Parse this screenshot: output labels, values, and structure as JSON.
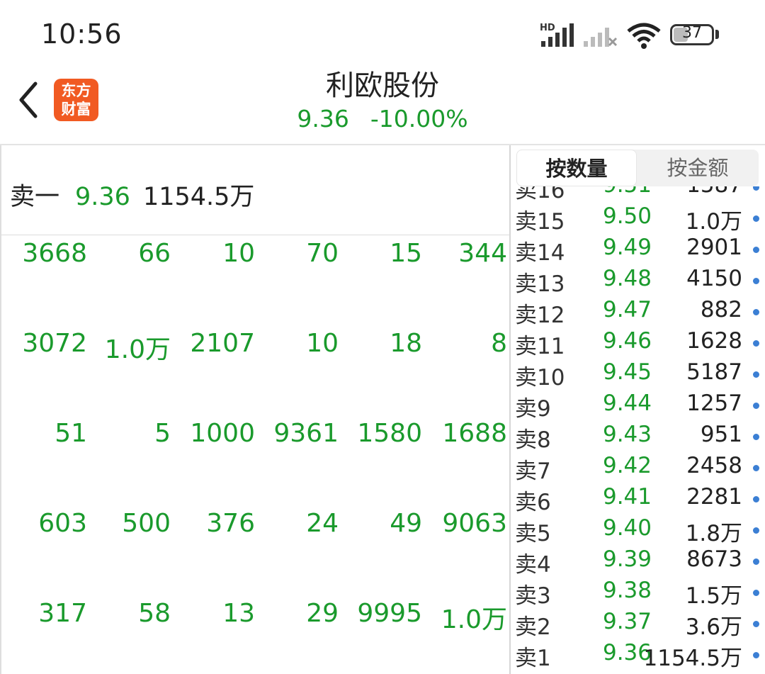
{
  "status_bar": {
    "time": "10:56",
    "battery": "37"
  },
  "header": {
    "logo_line1": "东方",
    "logo_line2": "财富",
    "title": "利欧股份",
    "price": "9.36",
    "change": "-10.00%"
  },
  "left": {
    "ask1_label": "卖一",
    "ask1_price": "9.36",
    "ask1_volume": "1154.5万",
    "grid": [
      [
        "3668",
        "66",
        "10",
        "70",
        "15",
        "344"
      ],
      [
        "3072",
        "1.0万",
        "2107",
        "10",
        "18",
        "8"
      ],
      [
        "51",
        "5",
        "1000",
        "9361",
        "1580",
        "1688"
      ],
      [
        "603",
        "500",
        "376",
        "24",
        "49",
        "9063"
      ],
      [
        "317",
        "58",
        "13",
        "29",
        "9995",
        "1.0万"
      ]
    ]
  },
  "right": {
    "tabs": [
      "按数量",
      "按金额"
    ],
    "partial_row": {
      "label": "卖16",
      "price": "9.51",
      "volume": "1587"
    },
    "rows": [
      {
        "label": "卖15",
        "price": "9.50",
        "volume": "1.0万"
      },
      {
        "label": "卖14",
        "price": "9.49",
        "volume": "2901"
      },
      {
        "label": "卖13",
        "price": "9.48",
        "volume": "4150"
      },
      {
        "label": "卖12",
        "price": "9.47",
        "volume": "882"
      },
      {
        "label": "卖11",
        "price": "9.46",
        "volume": "1628"
      },
      {
        "label": "卖10",
        "price": "9.45",
        "volume": "5187"
      },
      {
        "label": "卖9",
        "price": "9.44",
        "volume": "1257"
      },
      {
        "label": "卖8",
        "price": "9.43",
        "volume": "951"
      },
      {
        "label": "卖7",
        "price": "9.42",
        "volume": "2458"
      },
      {
        "label": "卖6",
        "price": "9.41",
        "volume": "2281"
      },
      {
        "label": "卖5",
        "price": "9.40",
        "volume": "1.8万"
      },
      {
        "label": "卖4",
        "price": "9.39",
        "volume": "8673"
      },
      {
        "label": "卖3",
        "price": "9.38",
        "volume": "1.5万"
      },
      {
        "label": "卖2",
        "price": "9.37",
        "volume": "3.6万"
      },
      {
        "label": "卖1",
        "price": "9.36",
        "volume": "1154.5万"
      }
    ]
  },
  "colors": {
    "down_green": "#1a9a2c",
    "brand_orange": "#f15a22",
    "dot_blue": "#3b7fd4"
  },
  "icons": [
    "signal-hd-icon",
    "signal-off-icon",
    "wifi-icon",
    "battery-icon",
    "back-chevron-icon",
    "eastmoney-logo-icon"
  ]
}
